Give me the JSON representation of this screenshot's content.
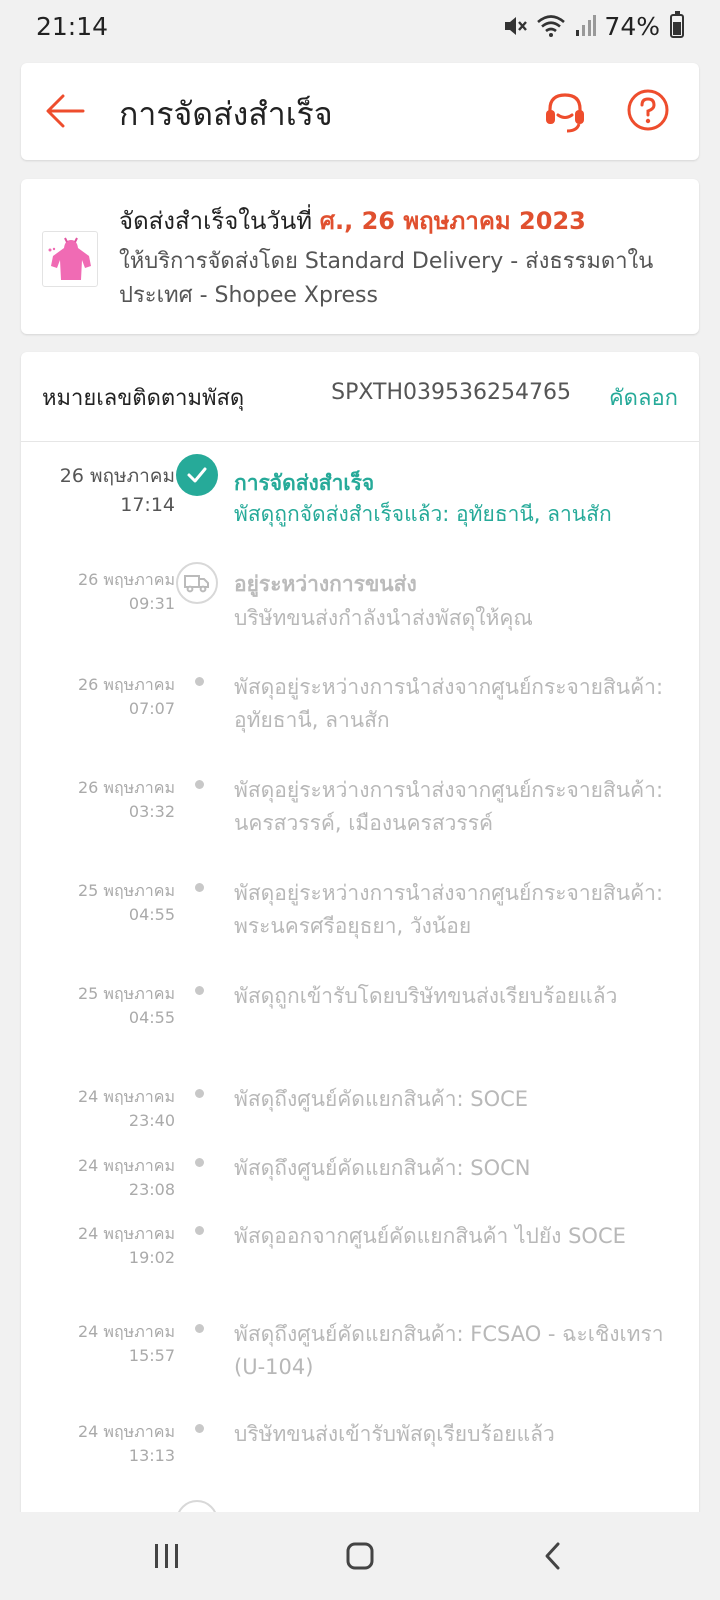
{
  "status_bar": {
    "time": "21:14",
    "battery": "74%",
    "battery_level": 0.74,
    "icons": [
      "mute-icon",
      "wifi-icon",
      "signal-icon",
      "battery-icon"
    ]
  },
  "header": {
    "title": "การจัดส่งสำเร็จ",
    "icons": [
      "back-arrow-icon",
      "headset-icon",
      "help-icon"
    ]
  },
  "delivery": {
    "line1_prefix": "จัดส่งสำเร็จในวันที่ ",
    "date": "ศ., 26 พฤษภาคม 2023",
    "line2": "ให้บริการจัดส่งโดย Standard Delivery - ส่งธรรมดาในประเทศ - Shopee Xpress"
  },
  "tracking": {
    "label": "หมายเลขติดตามพัสดุ",
    "number": "SPXTH039536254765",
    "copy_label": "คัดลอก"
  },
  "events": [
    {
      "date": "26 พฤษภาคม",
      "time": "17:14",
      "title": "การจัดส่งสำเร็จ",
      "desc": "พัสดุถูกจัดส่งสำเร็จแล้ว: อุทัยธานี, ลานสัก"
    },
    {
      "date": "26 พฤษภาคม",
      "time": "09:31",
      "title": "อยู่ระหว่างการขนส่ง",
      "desc": "บริษัทขนส่งกำลังนำส่งพัสดุให้คุณ"
    },
    {
      "date": "26 พฤษภาคม",
      "time": "07:07",
      "desc": "พัสดุอยู่ระหว่างการนำส่งจากศูนย์กระจายสินค้า: อุทัยธานี, ลานสัก"
    },
    {
      "date": "26 พฤษภาคม",
      "time": "03:32",
      "desc": "พัสดุอยู่ระหว่างการนำส่งจากศูนย์กระจายสินค้า: นครสวรรค์, เมืองนครสวรรค์"
    },
    {
      "date": "25 พฤษภาคม",
      "time": "04:55",
      "desc": "พัสดุอยู่ระหว่างการนำส่งจากศูนย์กระจายสินค้า: พระนครศรีอยุธยา, วังน้อย"
    },
    {
      "date": "25 พฤษภาคม",
      "time": "04:55",
      "desc": "พัสดุถูกเข้ารับโดยบริษัทขนส่งเรียบร้อยแล้ว"
    },
    {
      "date": "24 พฤษภาคม",
      "time": "23:40",
      "desc": "พัสดุถึงศูนย์คัดแยกสินค้า: SOCE"
    },
    {
      "date": "24 พฤษภาคม",
      "time": "23:08",
      "desc": "พัสดุถึงศูนย์คัดแยกสินค้า: SOCN"
    },
    {
      "date": "24 พฤษภาคม",
      "time": "19:02",
      "desc": "พัสดุออกจากศูนย์คัดแยกสินค้า ไปยัง SOCE"
    },
    {
      "date": "24 พฤษภาคม",
      "time": "15:57",
      "desc": "พัสดุถึงศูนย์คัดแยกสินค้า: FCSAO - ฉะเชิงเทรา (U-104)"
    },
    {
      "date": "24 พฤษภาคม",
      "time": "13:13",
      "desc": "บริษัทขนส่งเข้ารับพัสดุเรียบร้อยแล้ว"
    }
  ],
  "colors": {
    "accent": "#ee4d2d",
    "success": "#26aa99",
    "muted": "#b8b8b8"
  },
  "nav": {
    "icons": [
      "recent-apps-icon",
      "home-icon",
      "back-icon"
    ]
  }
}
